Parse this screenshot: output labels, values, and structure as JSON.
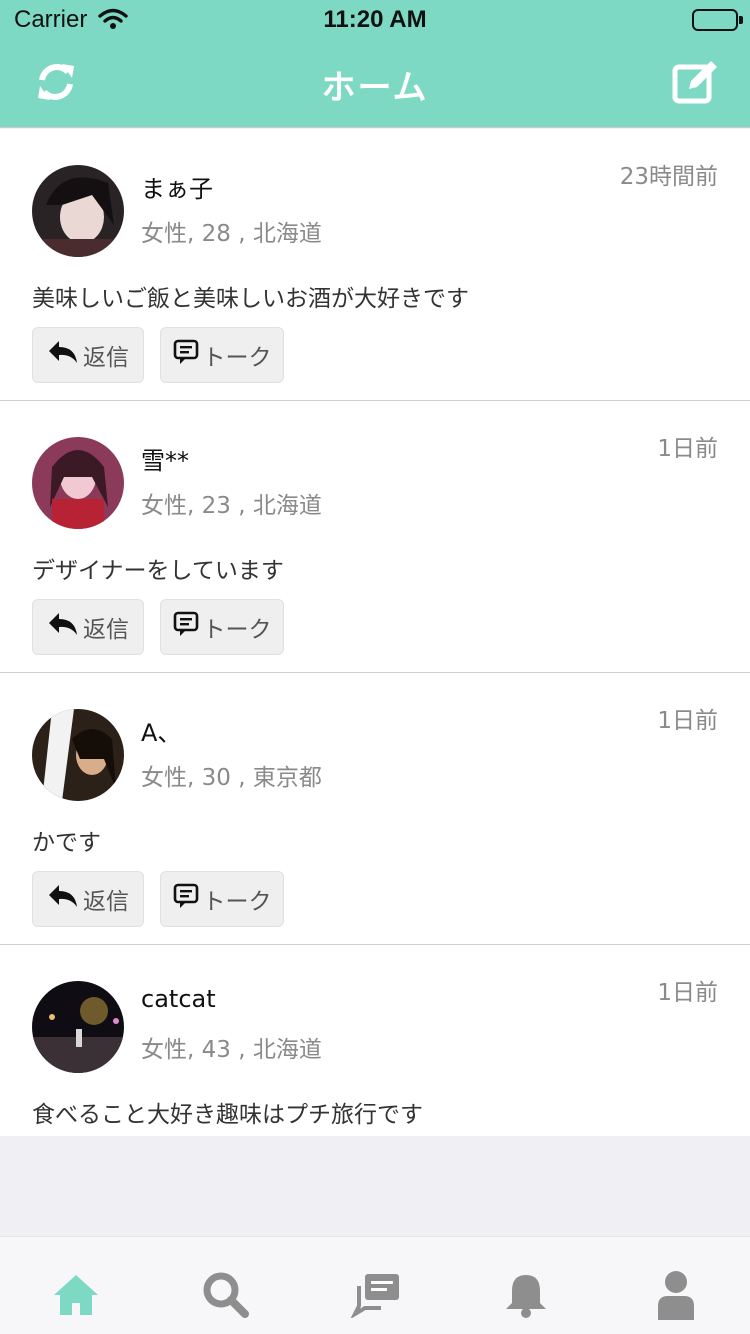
{
  "status_bar": {
    "carrier": "Carrier",
    "time": "11:20 AM"
  },
  "nav": {
    "title": "ホーム",
    "left_icon": "refresh-icon",
    "right_icon": "compose-icon"
  },
  "buttons": {
    "reply_label": "返信",
    "talk_label": "トーク"
  },
  "posts": [
    {
      "name": "まぁ子",
      "info": "女性, 28 , 北海道",
      "ago": "23時間前",
      "message": "美味しいご飯と美味しいお酒が大好きです"
    },
    {
      "name": "雪**",
      "info": "女性, 23 , 北海道",
      "ago": "1日前",
      "message": "デザイナーをしています"
    },
    {
      "name": "A、",
      "info": "女性, 30 , 東京都",
      "ago": "1日前",
      "message": "かです"
    },
    {
      "name": "catcat",
      "info": "女性, 43 , 北海道",
      "ago": "1日前",
      "message": "食べること大好き趣味はプチ旅行です"
    }
  ],
  "tabbar": {
    "items": [
      "home-icon",
      "search-icon",
      "chat-icon",
      "bell-icon",
      "profile-icon"
    ],
    "active": "home-icon"
  },
  "colors": {
    "accent": "#7dd9c4",
    "tab_inactive": "#8e8e8e"
  }
}
